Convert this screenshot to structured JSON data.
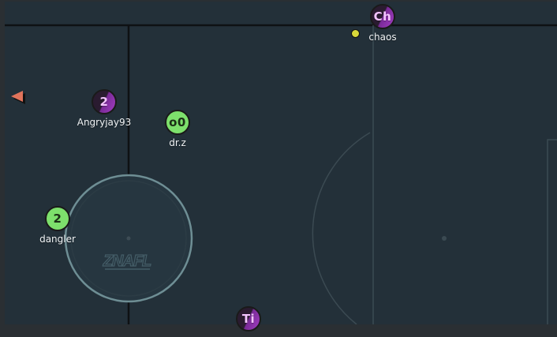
{
  "game": {
    "players": [
      {
        "id": "chaos",
        "team": "red",
        "avatar": "Ch",
        "name": "chaos"
      },
      {
        "id": "angryjay93",
        "team": "red",
        "avatar": "2",
        "name": "Angryjay93"
      },
      {
        "id": "drz",
        "team": "blue",
        "avatar": "o0",
        "name": "dr.z"
      },
      {
        "id": "dangler",
        "team": "blue",
        "avatar": "2",
        "name": "dangler"
      },
      {
        "id": "ti",
        "team": "red",
        "avatar": "Ti",
        "name": ""
      }
    ],
    "logo_text": "ZNAFL",
    "colors": {
      "background": "#233039",
      "red_team": "#a23ec2",
      "blue_team": "#7de06c",
      "ball": "#d8d83a",
      "offscreen_indicator": "#e0735b",
      "lines": "#111111",
      "circle": "#6e8e94"
    }
  }
}
